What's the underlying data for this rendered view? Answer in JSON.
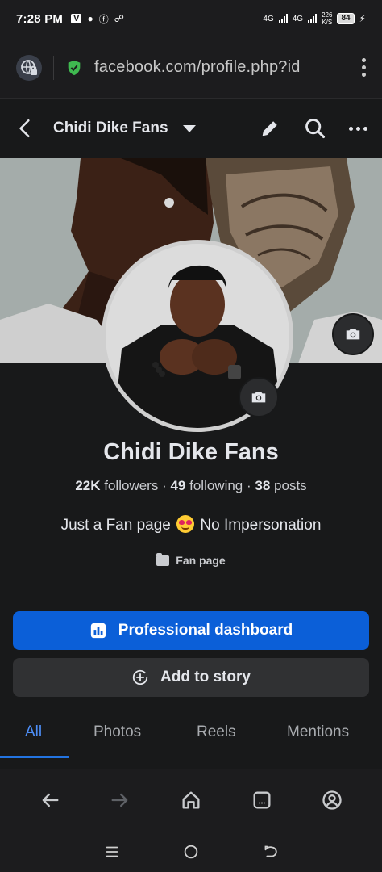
{
  "status_bar": {
    "time": "7:28 PM",
    "network_1": "4G",
    "network_2": "4G",
    "speed_value": "226",
    "speed_unit": "K/S",
    "battery": "84"
  },
  "browser": {
    "url": "facebook.com/profile.php?id"
  },
  "header": {
    "page_name": "Chidi Dike Fans"
  },
  "profile": {
    "name": "Chidi Dike Fans",
    "followers_count": "22K",
    "followers_label": "followers",
    "following_count": "49",
    "following_label": "following",
    "posts_count": "38",
    "posts_label": "posts",
    "bio_before": "Just a Fan page",
    "bio_after": "No Impersonation",
    "category": "Fan page"
  },
  "buttons": {
    "dashboard": "Professional dashboard",
    "add_story": "Add to story"
  },
  "tabs": [
    "All",
    "Photos",
    "Reels",
    "Mentions"
  ],
  "colors": {
    "primary": "#0b5fd8",
    "active_tab": "#4d8ef7",
    "background": "#18191a"
  }
}
